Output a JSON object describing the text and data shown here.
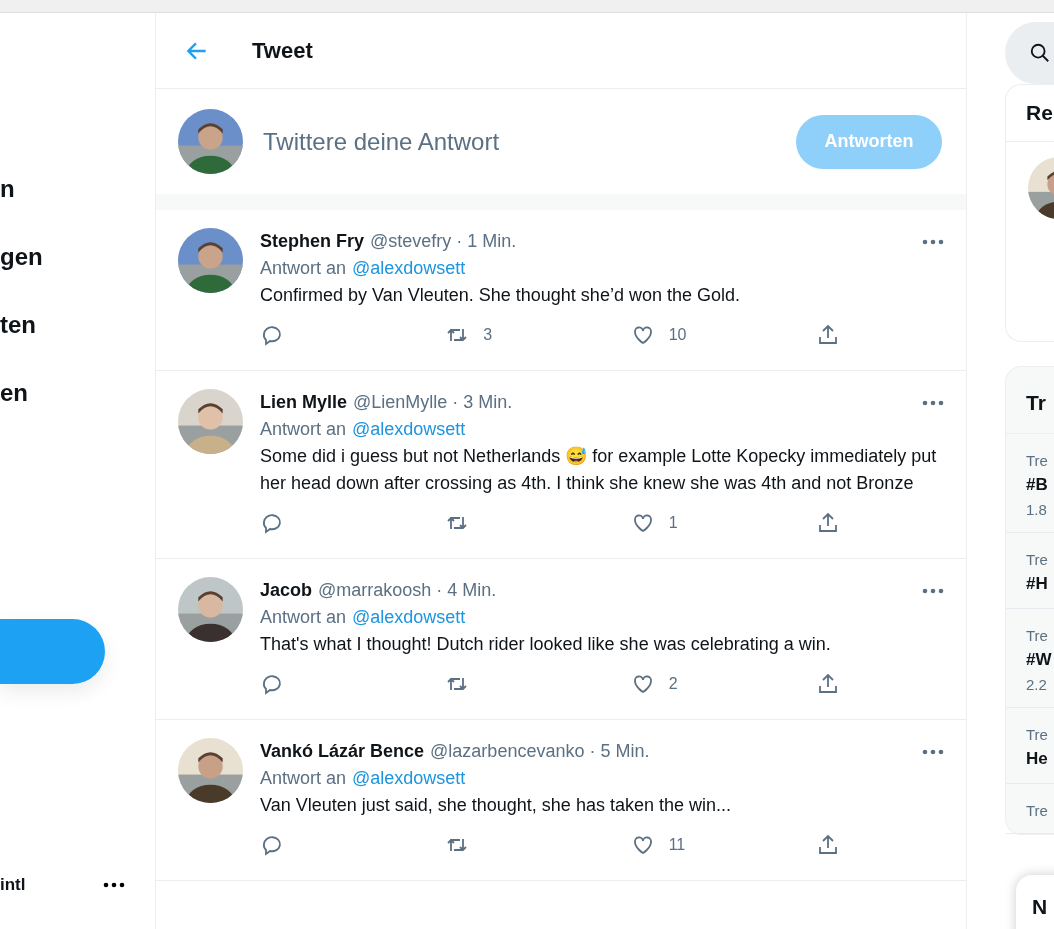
{
  "sidebar": {
    "nav_items": [
      "n",
      "gen",
      "ten",
      "en"
    ],
    "account_name": "intl"
  },
  "header": {
    "title": "Tweet"
  },
  "compose": {
    "placeholder": "Twittere deine Antwort",
    "button": "Antworten",
    "button_disabled": true
  },
  "tweets": [
    {
      "name": "Stephen Fry",
      "handle_time": "@stevefry · 1 Min.",
      "reply_label": "Antwort an",
      "reply_to": "@alexdowsett",
      "text": "Confirmed by Van Vleuten. She thought she’d won the Gold.",
      "retweets": "3",
      "likes": "10"
    },
    {
      "name": "Lien Mylle",
      "handle_time": "@LienMylle · 3 Min.",
      "reply_label": "Antwort an",
      "reply_to": "@alexdowsett",
      "text": "Some did i guess but not Netherlands 😅 for example Lotte Kopecky immediately put her head down after crossing as 4th. I think she knew she was 4th and not Bronze",
      "likes": "1"
    },
    {
      "name": "Jacob",
      "handle_time": "@marrakoosh · 4 Min.",
      "reply_label": "Antwort an",
      "reply_to": "@alexdowsett",
      "text": "That's what I thought! Dutch rider looked like she was celebrating a win.",
      "likes": "2"
    },
    {
      "name": "Vankó Lázár Bence",
      "handle_time": "@lazarbencevanko · 5 Min.",
      "reply_label": "Antwort an",
      "reply_to": "@alexdowsett",
      "text": "Van Vleuten just said, she thought, she has taken the win...",
      "likes": "11"
    }
  ],
  "right": {
    "follow_title": "Re",
    "trends_title": "Tr",
    "trends": [
      {
        "label": "Tre",
        "title": "#B",
        "count": "1.8"
      },
      {
        "label": "Tre",
        "title": "#H"
      },
      {
        "label": "Tre",
        "title": "#W",
        "count": "2.2"
      },
      {
        "label": "Tre",
        "title": "He"
      },
      {
        "label": "Tre"
      }
    ],
    "messages_title": "N"
  }
}
